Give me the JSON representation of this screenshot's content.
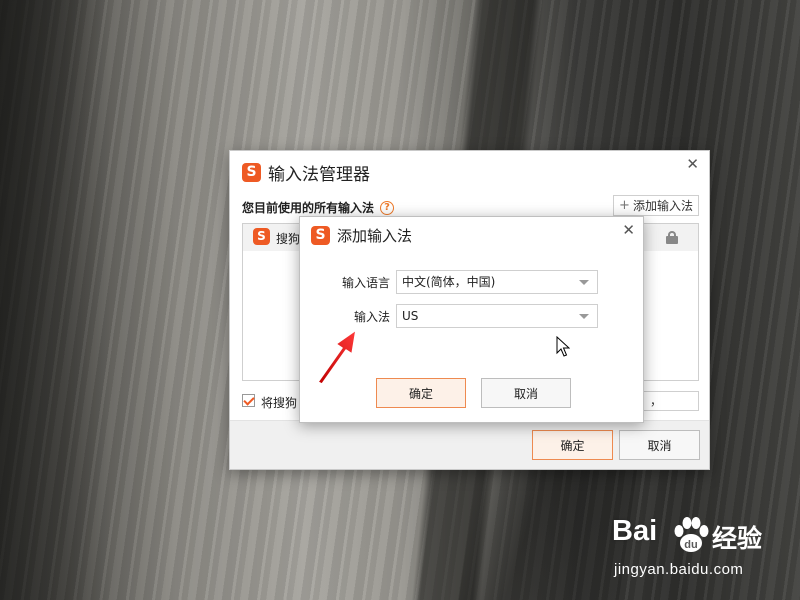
{
  "manager": {
    "title": "输入法管理器",
    "logo_letter": "S",
    "subtitle": "您目前使用的所有输入法",
    "add_button": "添加输入法",
    "list_item": "搜狗",
    "checkbox_label": "将搜狗",
    "small_field_text": "，",
    "ok": "确定",
    "cancel": "取消",
    "close": "✕"
  },
  "add_dialog": {
    "title": "添加输入法",
    "logo_letter": "S",
    "close": "✕",
    "language_label": "输入语言",
    "language_value": "中文(简体，中国)",
    "ime_label": "输入法",
    "ime_value": "US",
    "ok": "确定",
    "cancel": "取消"
  },
  "watermark": {
    "brand_left": "Bai",
    "brand_right": "经验",
    "url": "jingyan.baidu.com"
  },
  "colors": {
    "accent": "#ee5a24",
    "primary_button_border": "#ee8a50",
    "annotation_arrow": "#e01818"
  },
  "icons": [
    "sogou-logo-icon",
    "close-icon",
    "help-icon",
    "plus-icon",
    "lock-icon",
    "dropdown-arrow-icon",
    "mouse-cursor-icon",
    "red-arrow-annotation"
  ]
}
